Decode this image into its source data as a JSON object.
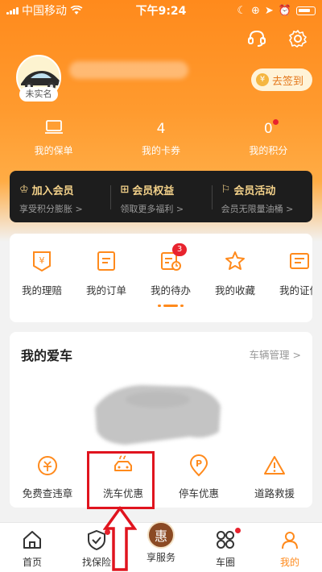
{
  "status": {
    "carrier": "中国移动",
    "time": "下午9:24"
  },
  "profile": {
    "unnamed_label": "未实名",
    "checkin_label": "去签到",
    "coin_glyph": "¥"
  },
  "stats": [
    {
      "value": "",
      "label": "我的保单"
    },
    {
      "value": "4",
      "label": "我的卡券"
    },
    {
      "value": "0",
      "label": "我的积分"
    }
  ],
  "membership": [
    {
      "title": "加入会员",
      "sub": "享受积分膨胀 >"
    },
    {
      "title": "会员权益",
      "sub": "领取更多福利 >"
    },
    {
      "title": "会员活动",
      "sub": "会员无限量油桶 >"
    }
  ],
  "functions": [
    {
      "label": "我的理赔"
    },
    {
      "label": "我的订单"
    },
    {
      "label": "我的待办",
      "badge": "3"
    },
    {
      "label": "我的收藏"
    },
    {
      "label": "我的证件"
    }
  ],
  "car": {
    "title": "我的爱车",
    "manage": "车辆管理 >",
    "services": [
      {
        "label": "免费查违章"
      },
      {
        "label": "洗车优惠"
      },
      {
        "label": "停车优惠"
      },
      {
        "label": "道路救援"
      }
    ]
  },
  "tabs": [
    {
      "label": "首页"
    },
    {
      "label": "找保险"
    },
    {
      "label": "享服务",
      "glyph": "惠"
    },
    {
      "label": "车圈"
    },
    {
      "label": "我的"
    }
  ],
  "colors": {
    "brand": "#ff8a1c",
    "gold": "#f4d28a",
    "highlight": "#e0141e"
  }
}
